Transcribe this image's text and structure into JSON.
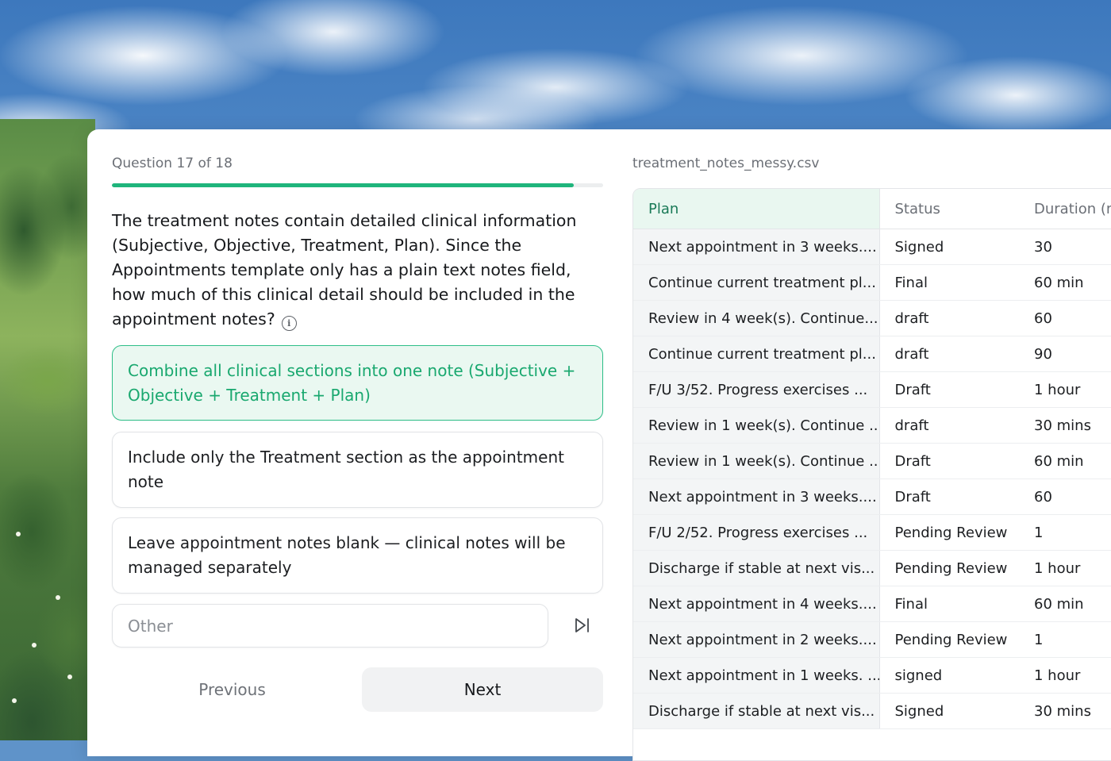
{
  "progress": {
    "counter_label": "Question 17 of 18",
    "fraction": 0.94
  },
  "question": {
    "text": "The treatment notes contain detailed clinical information (Subjective, Objective, Treatment, Plan). Since the Appointments template only has a plain text notes field, how much of this clinical detail should be included in the appointment notes?",
    "info_icon": "info-icon"
  },
  "options": [
    {
      "label": "Combine all clinical sections into one note (Subjective + Objective + Treatment + Plan)",
      "selected": true
    },
    {
      "label": "Include only the Treatment section as the appointment note",
      "selected": false
    },
    {
      "label": "Leave appointment notes blank — clinical notes will be managed separately",
      "selected": false
    }
  ],
  "other": {
    "placeholder": "Other",
    "value": "",
    "skip_icon": "skip-forward-icon"
  },
  "nav": {
    "previous_label": "Previous",
    "next_label": "Next"
  },
  "file": {
    "name": "treatment_notes_messy.csv",
    "columns": [
      "Plan",
      "Status",
      "Duration (m"
    ],
    "rows": [
      [
        "Next appointment in 3 weeks....",
        "Signed",
        "30"
      ],
      [
        "Continue current treatment pl...",
        "Final",
        "60 min"
      ],
      [
        "Review in 4 week(s). Continue...",
        "draft",
        "60"
      ],
      [
        "Continue current treatment pl...",
        "draft",
        "90"
      ],
      [
        "F/U 3/52. Progress exercises ...",
        "Draft",
        "1 hour"
      ],
      [
        "Review in 1 week(s). Continue ...",
        "draft",
        "30 mins"
      ],
      [
        "Review in 1 week(s). Continue ...",
        "Draft",
        "60 min"
      ],
      [
        "Next appointment in 3 weeks....",
        "Draft",
        "60"
      ],
      [
        "F/U 2/52. Progress exercises ...",
        "Pending Review",
        "1"
      ],
      [
        "Discharge if stable at next vis...",
        "Pending Review",
        "1 hour"
      ],
      [
        "Next appointment in 4 weeks....",
        "Final",
        "60 min"
      ],
      [
        "Next appointment in 2 weeks....",
        "Pending Review",
        "1"
      ],
      [
        "Next appointment in 1 weeks. ...",
        "signed",
        "1 hour"
      ],
      [
        "Discharge if stable at next vis...",
        "Signed",
        "30 mins"
      ]
    ]
  },
  "colors": {
    "accent": "#1fb57c",
    "selected_bg": "#eaf8f1",
    "selected_text": "#19a86f"
  }
}
